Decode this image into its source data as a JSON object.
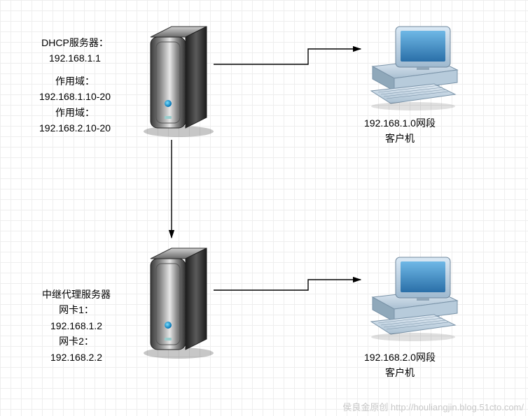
{
  "dhcp_server": {
    "title": "DHCP服务器：",
    "ip": "192.168.1.1",
    "scope1_label": "作用域：",
    "scope1_range": "192.168.1.10-20",
    "scope2_label": "作用域：",
    "scope2_range": "192.168.2.10-20"
  },
  "relay_server": {
    "title": "中继代理服务器",
    "nic1_label": "网卡1：",
    "nic1_ip": "192.168.1.2",
    "nic2_label": "网卡2：",
    "nic2_ip": "192.168.2.2"
  },
  "client1": {
    "line1": "192.168.1.0网段",
    "line2": "客户机"
  },
  "client2": {
    "line1": "192.168.2.0网段",
    "line2": "客户机"
  },
  "watermark": "侯良金原创 http://houliangjin.blog.51cto.com/"
}
